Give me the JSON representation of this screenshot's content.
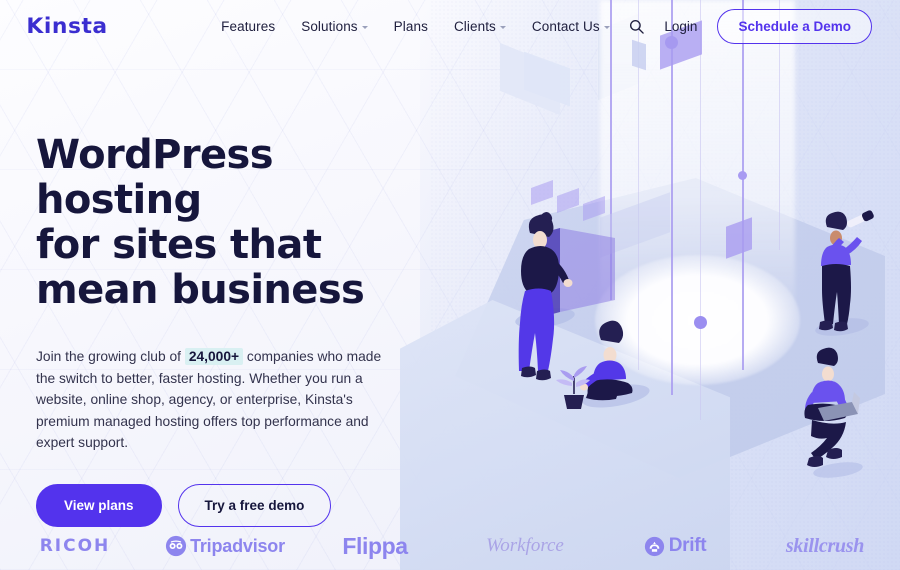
{
  "brand": {
    "logo_text": "Kinsta",
    "accent_color": "#5333ed",
    "headline_color": "#16163c",
    "logo_color": "#3b2ed0",
    "highlight_color": "#d9f0f2",
    "logobar_color": "#8d85ee"
  },
  "header": {
    "nav": [
      {
        "label": "Features",
        "has_dropdown": false
      },
      {
        "label": "Solutions",
        "has_dropdown": true
      },
      {
        "label": "Plans",
        "has_dropdown": false
      },
      {
        "label": "Clients",
        "has_dropdown": true
      },
      {
        "label": "Contact Us",
        "has_dropdown": true
      }
    ],
    "search_icon": "search-icon",
    "login_label": "Login",
    "cta_label": "Schedule a Demo"
  },
  "hero": {
    "headline_line1": "WordPress hosting",
    "headline_line2": "for sites that",
    "headline_line3": "mean business",
    "paragraph_before": "Join the growing club of",
    "paragraph_highlight": "24,000+",
    "paragraph_after": "companies who made the switch to better, faster hosting. Whether you run a website, online shop, agency, or enterprise, Kinsta's premium managed hosting offers top performance and expert support.",
    "primary_button": "View plans",
    "secondary_button": "Try a free demo"
  },
  "logobar": {
    "items": [
      {
        "name": "RICOH",
        "style": "ricoh"
      },
      {
        "name": "Tripadvisor",
        "style": "tripadvisor"
      },
      {
        "name": "Flippa",
        "style": "flippa"
      },
      {
        "name": "Workforce",
        "style": "workforce"
      },
      {
        "name": "Drift",
        "style": "drift"
      },
      {
        "name": "skillcrush",
        "style": "skillcrush"
      }
    ]
  },
  "illustration": {
    "description": "isometric platform with four people",
    "figures": [
      "woman-standing-at-screen",
      "woman-sitting-with-plant",
      "man-with-telescope",
      "man-sitting-with-laptop"
    ]
  }
}
